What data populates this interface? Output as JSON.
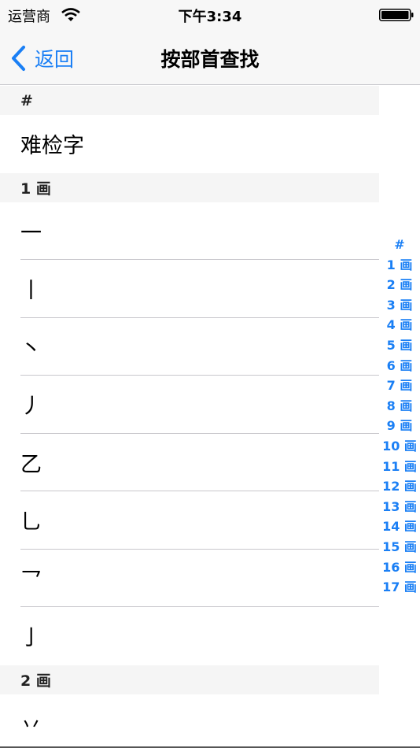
{
  "status": {
    "carrier": "运营商",
    "time": "下午3:34"
  },
  "nav": {
    "back_label": "返回",
    "title": "按部首查找"
  },
  "sections": [
    {
      "header": "#",
      "rows": [
        "难检字"
      ]
    },
    {
      "header": "1 画",
      "rows": [
        "一",
        "丨",
        "丶",
        "丿",
        "乙",
        "乚",
        "乛",
        "亅"
      ]
    },
    {
      "header": "2 画",
      "rows": [
        "丷"
      ]
    }
  ],
  "index": [
    "#",
    "1 画",
    "2 画",
    "3 画",
    "4 画",
    "5 画",
    "6 画",
    "7 画",
    "8 画",
    "9 画",
    "10 画",
    "11 画",
    "12 画",
    "13 画",
    "14 画",
    "15 画",
    "16 画",
    "17 画"
  ],
  "colors": {
    "accent": "#1a7ff5",
    "section_bg": "#f5f5f5",
    "bar_bg": "#f7f7f7"
  }
}
